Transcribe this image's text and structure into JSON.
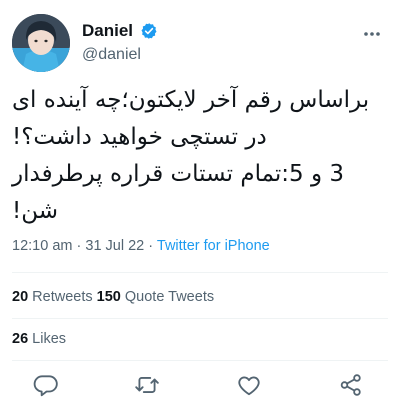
{
  "user": {
    "display_name": "Daniel",
    "handle": "@daniel",
    "verified": true
  },
  "tweet": {
    "lines": [
      "براساس رقم آخر لایکتون؛چه آینده ای",
      "در تستچی خواهید داشت؟!",
      "3 و 5:تمام تستات قراره پرطرفدار",
      "شن!"
    ],
    "time": "12:10 am",
    "separator": "·",
    "date": "31 Jul 22",
    "source": "Twitter for iPhone"
  },
  "stats": {
    "retweets_count": "20",
    "retweets_label": "Retweets",
    "quotes_count": "150",
    "quotes_label": "Quote Tweets",
    "likes_count": "26",
    "likes_label": "Likes"
  },
  "icons": {
    "more": "more-dots-icon",
    "reply": "reply-icon",
    "retweet": "retweet-icon",
    "like": "like-icon",
    "share": "share-icon",
    "verified": "verified-badge-icon"
  },
  "colors": {
    "accent": "#1d9bf0",
    "secondary_text": "#536471",
    "primary_text": "#0f1419",
    "divider": "#eff3f4"
  }
}
